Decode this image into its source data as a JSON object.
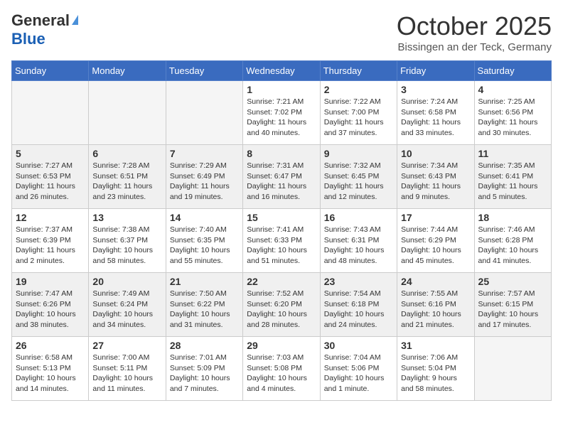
{
  "header": {
    "logo_general": "General",
    "logo_blue": "Blue",
    "month_title": "October 2025",
    "location": "Bissingen an der Teck, Germany"
  },
  "weekdays": [
    "Sunday",
    "Monday",
    "Tuesday",
    "Wednesday",
    "Thursday",
    "Friday",
    "Saturday"
  ],
  "weeks": [
    [
      {
        "day": "",
        "info": ""
      },
      {
        "day": "",
        "info": ""
      },
      {
        "day": "",
        "info": ""
      },
      {
        "day": "1",
        "info": "Sunrise: 7:21 AM\nSunset: 7:02 PM\nDaylight: 11 hours and 40 minutes."
      },
      {
        "day": "2",
        "info": "Sunrise: 7:22 AM\nSunset: 7:00 PM\nDaylight: 11 hours and 37 minutes."
      },
      {
        "day": "3",
        "info": "Sunrise: 7:24 AM\nSunset: 6:58 PM\nDaylight: 11 hours and 33 minutes."
      },
      {
        "day": "4",
        "info": "Sunrise: 7:25 AM\nSunset: 6:56 PM\nDaylight: 11 hours and 30 minutes."
      }
    ],
    [
      {
        "day": "5",
        "info": "Sunrise: 7:27 AM\nSunset: 6:53 PM\nDaylight: 11 hours and 26 minutes."
      },
      {
        "day": "6",
        "info": "Sunrise: 7:28 AM\nSunset: 6:51 PM\nDaylight: 11 hours and 23 minutes."
      },
      {
        "day": "7",
        "info": "Sunrise: 7:29 AM\nSunset: 6:49 PM\nDaylight: 11 hours and 19 minutes."
      },
      {
        "day": "8",
        "info": "Sunrise: 7:31 AM\nSunset: 6:47 PM\nDaylight: 11 hours and 16 minutes."
      },
      {
        "day": "9",
        "info": "Sunrise: 7:32 AM\nSunset: 6:45 PM\nDaylight: 11 hours and 12 minutes."
      },
      {
        "day": "10",
        "info": "Sunrise: 7:34 AM\nSunset: 6:43 PM\nDaylight: 11 hours and 9 minutes."
      },
      {
        "day": "11",
        "info": "Sunrise: 7:35 AM\nSunset: 6:41 PM\nDaylight: 11 hours and 5 minutes."
      }
    ],
    [
      {
        "day": "12",
        "info": "Sunrise: 7:37 AM\nSunset: 6:39 PM\nDaylight: 11 hours and 2 minutes."
      },
      {
        "day": "13",
        "info": "Sunrise: 7:38 AM\nSunset: 6:37 PM\nDaylight: 10 hours and 58 minutes."
      },
      {
        "day": "14",
        "info": "Sunrise: 7:40 AM\nSunset: 6:35 PM\nDaylight: 10 hours and 55 minutes."
      },
      {
        "day": "15",
        "info": "Sunrise: 7:41 AM\nSunset: 6:33 PM\nDaylight: 10 hours and 51 minutes."
      },
      {
        "day": "16",
        "info": "Sunrise: 7:43 AM\nSunset: 6:31 PM\nDaylight: 10 hours and 48 minutes."
      },
      {
        "day": "17",
        "info": "Sunrise: 7:44 AM\nSunset: 6:29 PM\nDaylight: 10 hours and 45 minutes."
      },
      {
        "day": "18",
        "info": "Sunrise: 7:46 AM\nSunset: 6:28 PM\nDaylight: 10 hours and 41 minutes."
      }
    ],
    [
      {
        "day": "19",
        "info": "Sunrise: 7:47 AM\nSunset: 6:26 PM\nDaylight: 10 hours and 38 minutes."
      },
      {
        "day": "20",
        "info": "Sunrise: 7:49 AM\nSunset: 6:24 PM\nDaylight: 10 hours and 34 minutes."
      },
      {
        "day": "21",
        "info": "Sunrise: 7:50 AM\nSunset: 6:22 PM\nDaylight: 10 hours and 31 minutes."
      },
      {
        "day": "22",
        "info": "Sunrise: 7:52 AM\nSunset: 6:20 PM\nDaylight: 10 hours and 28 minutes."
      },
      {
        "day": "23",
        "info": "Sunrise: 7:54 AM\nSunset: 6:18 PM\nDaylight: 10 hours and 24 minutes."
      },
      {
        "day": "24",
        "info": "Sunrise: 7:55 AM\nSunset: 6:16 PM\nDaylight: 10 hours and 21 minutes."
      },
      {
        "day": "25",
        "info": "Sunrise: 7:57 AM\nSunset: 6:15 PM\nDaylight: 10 hours and 17 minutes."
      }
    ],
    [
      {
        "day": "26",
        "info": "Sunrise: 6:58 AM\nSunset: 5:13 PM\nDaylight: 10 hours and 14 minutes."
      },
      {
        "day": "27",
        "info": "Sunrise: 7:00 AM\nSunset: 5:11 PM\nDaylight: 10 hours and 11 minutes."
      },
      {
        "day": "28",
        "info": "Sunrise: 7:01 AM\nSunset: 5:09 PM\nDaylight: 10 hours and 7 minutes."
      },
      {
        "day": "29",
        "info": "Sunrise: 7:03 AM\nSunset: 5:08 PM\nDaylight: 10 hours and 4 minutes."
      },
      {
        "day": "30",
        "info": "Sunrise: 7:04 AM\nSunset: 5:06 PM\nDaylight: 10 hours and 1 minute."
      },
      {
        "day": "31",
        "info": "Sunrise: 7:06 AM\nSunset: 5:04 PM\nDaylight: 9 hours and 58 minutes."
      },
      {
        "day": "",
        "info": ""
      }
    ]
  ]
}
